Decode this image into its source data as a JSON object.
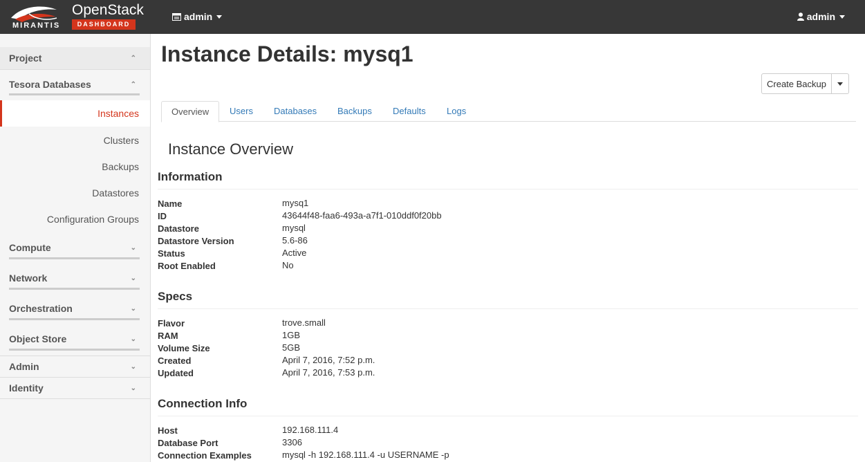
{
  "brand": {
    "logo_text": "MIRANTIS",
    "product_name": "OpenStack",
    "product_badge": "DASHBOARD",
    "accent_color": "#d4351c"
  },
  "topbar": {
    "project_label": "admin",
    "user_label": "admin",
    "project_icon": "project-icon",
    "user_icon": "user-icon"
  },
  "sidebar": {
    "project": "Project",
    "tesora": "Tesora Databases",
    "links": {
      "instances": "Instances",
      "clusters": "Clusters",
      "backups": "Backups",
      "datastores": "Datastores",
      "config_groups": "Configuration Groups"
    },
    "compute": "Compute",
    "network": "Network",
    "orchestration": "Orchestration",
    "object_store": "Object Store",
    "admin": "Admin",
    "identity": "Identity"
  },
  "page": {
    "title": "Instance Details: mysq1",
    "create_backup": "Create Backup"
  },
  "tabs": {
    "overview": "Overview",
    "users": "Users",
    "databases": "Databases",
    "backups": "Backups",
    "defaults": "Defaults",
    "logs": "Logs"
  },
  "overview": {
    "heading": "Instance Overview",
    "information": {
      "title": "Information",
      "rows": [
        {
          "label": "Name",
          "value": "mysq1"
        },
        {
          "label": "ID",
          "value": "43644f48-faa6-493a-a7f1-010ddf0f20bb"
        },
        {
          "label": "Datastore",
          "value": "mysql"
        },
        {
          "label": "Datastore Version",
          "value": "5.6-86"
        },
        {
          "label": "Status",
          "value": "Active"
        },
        {
          "label": "Root Enabled",
          "value": "No"
        }
      ]
    },
    "specs": {
      "title": "Specs",
      "rows": [
        {
          "label": "Flavor",
          "value": "trove.small"
        },
        {
          "label": "RAM",
          "value": "1GB"
        },
        {
          "label": "Volume Size",
          "value": "5GB"
        },
        {
          "label": "Created",
          "value": "April 7, 2016, 7:52 p.m."
        },
        {
          "label": "Updated",
          "value": "April 7, 2016, 7:53 p.m."
        }
      ]
    },
    "connection": {
      "title": "Connection Info",
      "rows": [
        {
          "label": "Host",
          "value": "192.168.111.4"
        },
        {
          "label": "Database Port",
          "value": "3306"
        },
        {
          "label": "Connection Examples",
          "value": "mysql -h 192.168.111.4 -u USERNAME -p"
        }
      ]
    }
  }
}
